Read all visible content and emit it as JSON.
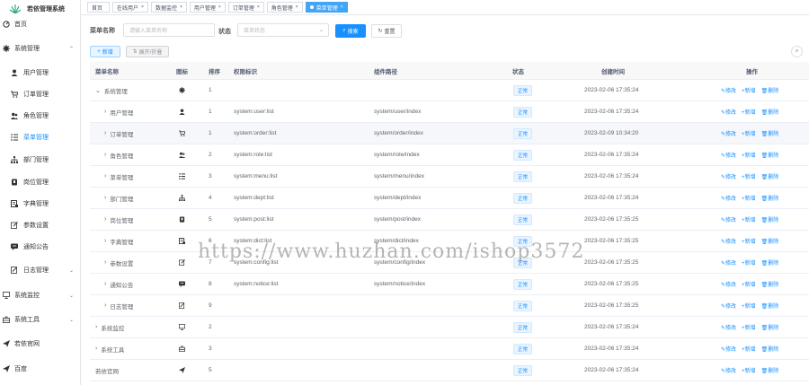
{
  "app": {
    "title": "若依管理系统"
  },
  "sidebar": {
    "items": [
      {
        "label": "首页",
        "icon": "dashboard-icon",
        "active": false,
        "chevron": ""
      },
      {
        "label": "系统管理",
        "icon": "gear-icon",
        "active": false,
        "chevron": "⌃"
      },
      {
        "label": "用户管理",
        "icon": "user-icon",
        "active": false,
        "chevron": ""
      },
      {
        "label": "订单管理",
        "icon": "cart-icon",
        "active": false,
        "chevron": ""
      },
      {
        "label": "角色管理",
        "icon": "people-icon",
        "active": false,
        "chevron": ""
      },
      {
        "label": "菜单管理",
        "icon": "tree-list-icon",
        "active": true,
        "chevron": ""
      },
      {
        "label": "部门管理",
        "icon": "org-tree-icon",
        "active": false,
        "chevron": ""
      },
      {
        "label": "岗位管理",
        "icon": "post-icon",
        "active": false,
        "chevron": ""
      },
      {
        "label": "字典管理",
        "icon": "dict-icon",
        "active": false,
        "chevron": ""
      },
      {
        "label": "参数设置",
        "icon": "edit-icon",
        "active": false,
        "chevron": ""
      },
      {
        "label": "通知公告",
        "icon": "message-icon",
        "active": false,
        "chevron": ""
      },
      {
        "label": "日志管理",
        "icon": "log-icon",
        "active": false,
        "chevron": "⌄"
      },
      {
        "label": "系统监控",
        "icon": "monitor-icon",
        "active": false,
        "chevron": "⌄"
      },
      {
        "label": "系统工具",
        "icon": "toolbox-icon",
        "active": false,
        "chevron": "⌄"
      },
      {
        "label": "若依官网",
        "icon": "send-icon",
        "active": false,
        "chevron": ""
      },
      {
        "label": "百度",
        "icon": "send-icon",
        "active": false,
        "chevron": ""
      }
    ]
  },
  "tabs": [
    {
      "label": "首页",
      "active": false,
      "close": ""
    },
    {
      "label": "在线用户",
      "active": false,
      "close": "×"
    },
    {
      "label": "数据监控",
      "active": false,
      "close": "×"
    },
    {
      "label": "用户管理",
      "active": false,
      "close": "×"
    },
    {
      "label": "订单管理",
      "active": false,
      "close": "×"
    },
    {
      "label": "角色管理",
      "active": false,
      "close": "×"
    },
    {
      "label": "菜单管理",
      "active": true,
      "close": "×"
    }
  ],
  "search": {
    "menu_name_label": "菜单名称",
    "menu_name_placeholder": "请输入菜单名称",
    "status_label": "状态",
    "status_placeholder": "菜单状态",
    "search_button": "搜索",
    "reset_button": "重置"
  },
  "toolbar": {
    "add_button": "新增",
    "expand_button": "展开/折叠"
  },
  "table": {
    "headers": {
      "name": "菜单名称",
      "icon": "图标",
      "order": "排序",
      "perms": "权限标识",
      "component": "组件路径",
      "status": "状态",
      "created": "创建时间",
      "ops": "操作"
    },
    "rows": [
      {
        "name": "系统管理",
        "arrow": "⌄",
        "indent": 1,
        "icon": "gear-icon",
        "order": "1",
        "perms": "",
        "component": "",
        "status": "正常",
        "created": "2023-02-06 17:35:24"
      },
      {
        "name": "用户管理",
        "arrow": "›",
        "indent": 2,
        "icon": "user-icon",
        "order": "1",
        "perms": "system:user:list",
        "component": "system/user/index",
        "status": "正常",
        "created": "2023-02-06 17:35:24"
      },
      {
        "name": "订单管理",
        "arrow": "›",
        "indent": 2,
        "icon": "cart-icon",
        "order": "1",
        "perms": "system:order:list",
        "component": "system/order/index",
        "status": "正常",
        "created": "2023-02-09 10:34:20",
        "highlight": true
      },
      {
        "name": "角色管理",
        "arrow": "›",
        "indent": 2,
        "icon": "people-icon",
        "order": "2",
        "perms": "system:role:list",
        "component": "system/role/index",
        "status": "正常",
        "created": "2023-02-06 17:35:24"
      },
      {
        "name": "菜单管理",
        "arrow": "›",
        "indent": 2,
        "icon": "tree-list-icon",
        "order": "3",
        "perms": "system:menu:list",
        "component": "system/menu/index",
        "status": "正常",
        "created": "2023-02-06 17:35:24"
      },
      {
        "name": "部门管理",
        "arrow": "›",
        "indent": 2,
        "icon": "org-tree-icon",
        "order": "4",
        "perms": "system:dept:list",
        "component": "system/dept/index",
        "status": "正常",
        "created": "2023-02-06 17:35:24"
      },
      {
        "name": "岗位管理",
        "arrow": "›",
        "indent": 2,
        "icon": "post-icon",
        "order": "5",
        "perms": "system:post:list",
        "component": "system/post/index",
        "status": "正常",
        "created": "2023-02-06 17:35:25"
      },
      {
        "name": "字典管理",
        "arrow": "›",
        "indent": 2,
        "icon": "dict-icon",
        "order": "6",
        "perms": "system:dict:list",
        "component": "system/dict/index",
        "status": "正常",
        "created": "2023-02-06 17:35:25"
      },
      {
        "name": "参数设置",
        "arrow": "›",
        "indent": 2,
        "icon": "edit-icon",
        "order": "7",
        "perms": "system:config:list",
        "component": "system/config/index",
        "status": "正常",
        "created": "2023-02-06 17:35:25"
      },
      {
        "name": "通知公告",
        "arrow": "›",
        "indent": 2,
        "icon": "message-icon",
        "order": "8",
        "perms": "system:notice:list",
        "component": "system/notice/index",
        "status": "正常",
        "created": "2023-02-06 17:35:25"
      },
      {
        "name": "日志管理",
        "arrow": "›",
        "indent": 2,
        "icon": "log-icon",
        "order": "9",
        "perms": "",
        "component": "",
        "status": "正常",
        "created": "2023-02-06 17:35:25"
      },
      {
        "name": "系统监控",
        "arrow": "›",
        "indent": 1,
        "icon": "monitor-icon",
        "order": "2",
        "perms": "",
        "component": "",
        "status": "正常",
        "created": "2023-02-06 17:35:24"
      },
      {
        "name": "系统工具",
        "arrow": "›",
        "indent": 1,
        "icon": "toolbox-icon",
        "order": "3",
        "perms": "",
        "component": "",
        "status": "正常",
        "created": "2023-02-06 17:35:24"
      },
      {
        "name": "若依官网",
        "arrow": "",
        "indent": 0,
        "icon": "send-icon",
        "order": "5",
        "perms": "",
        "component": "",
        "status": "正常",
        "created": "2023-02-06 17:35:24"
      }
    ],
    "ops": {
      "edit": "修改",
      "add": "新增",
      "delete": "删除"
    }
  },
  "watermark": "https://www.huzhan.com/ishop3572",
  "colors": {
    "primary": "#1890ff",
    "active_tab": "#42a5f5"
  }
}
